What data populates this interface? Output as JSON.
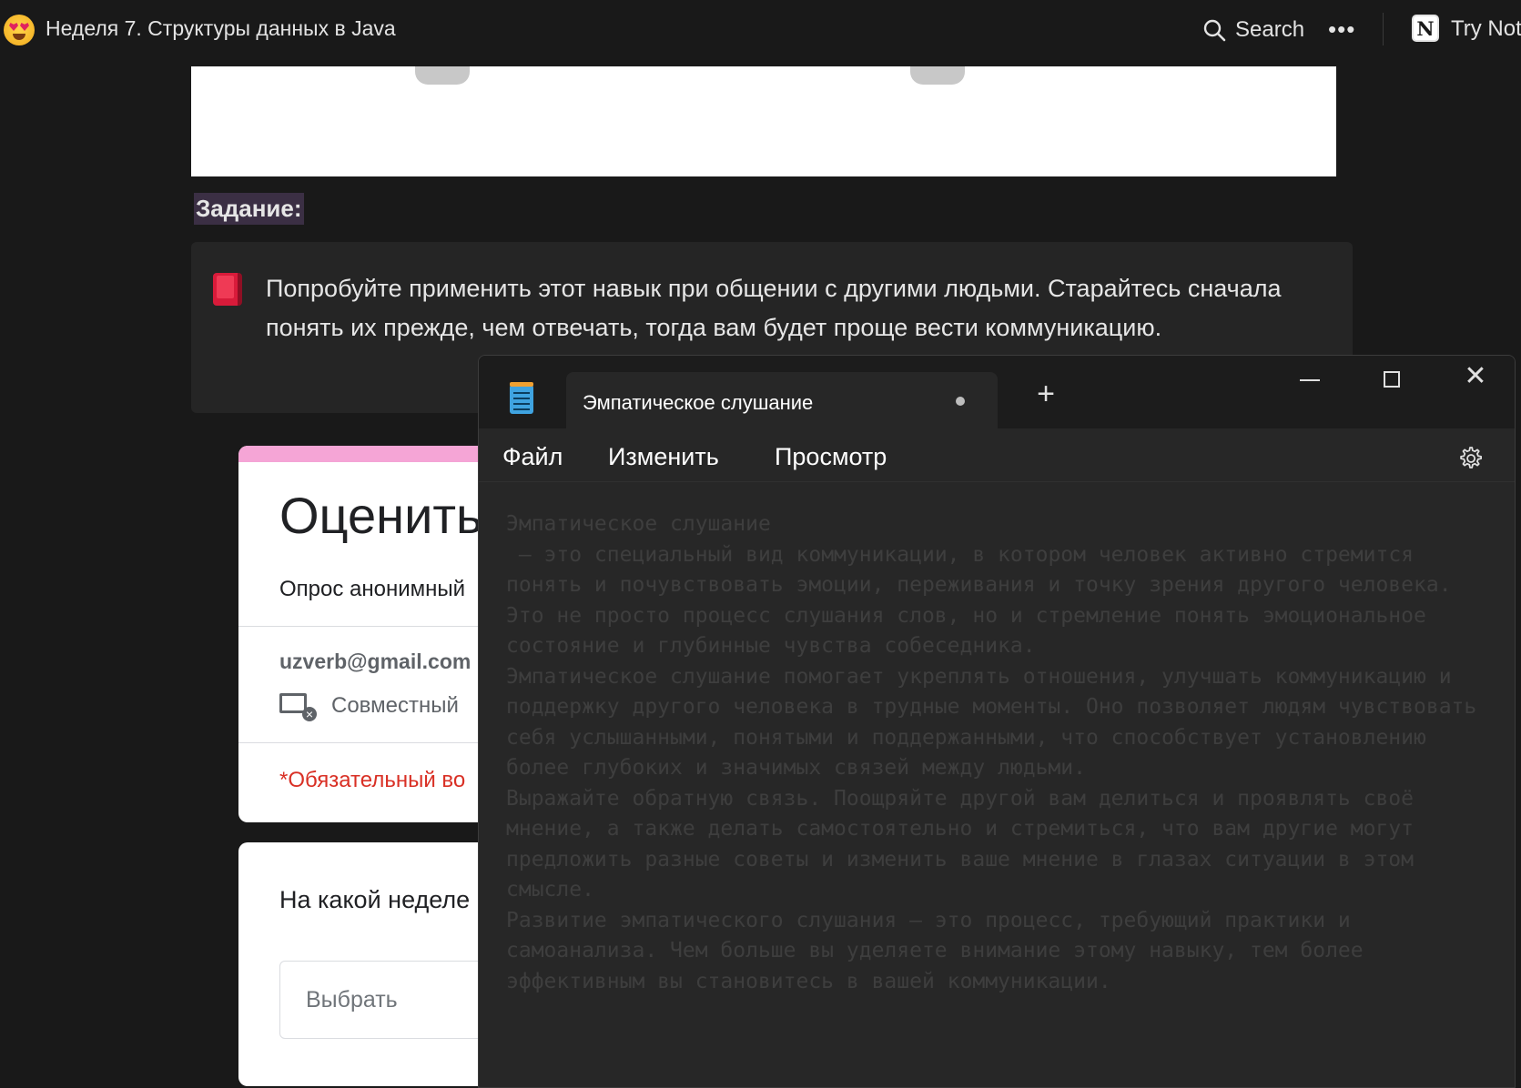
{
  "topbar": {
    "page_title": "Неделя 7. Структуры данных в Java",
    "page_icon": "smiling-face-with-heart-eyes",
    "search_label": "Search",
    "more_label": "•••",
    "try_notion_label": "Try Notion"
  },
  "content": {
    "task_heading": "Задание:",
    "callout_icon": "red-book",
    "callout_text": "Попробуйте применить этот навык при общении с другими людьми. Старайтесь сначала понять их прежде, чем отвечать, тогда вам будет проще вести коммуникацию."
  },
  "form": {
    "accent_color": "#f5a5d6",
    "title": "Оценить",
    "description": "Опрос анонимный",
    "email": "uzverb@gmail.com",
    "shared_label": "Совместный",
    "required_note": "*Обязательный во",
    "question": "На какой неделе",
    "select_placeholder": "Выбрать"
  },
  "notepad": {
    "tab_title": "Эмпатическое слушание",
    "menu": [
      "Файл",
      "Изменить",
      "Просмотр"
    ],
    "text": "Эмпатическое слушание\n — это специальный вид коммуникации, в котором человек активно стремится понять и почувствовать эмоции, переживания и точку зрения другого человека. Это не просто процесс слушания слов, но и стремление понять эмоциональное состояние и глубинные чувства собеседника.\nЭмпатическое слушание помогает укреплять отношения, улучшать коммуникацию и поддержку другого человека в трудные моменты. Оно позволяет людям чувствовать себя услышанными, понятыми и поддержанными, что способствует установлению более глубоких и значимых связей между людьми.\nВыражайте обратную связь. Поощряйте другой вам делиться и проявлять своё мнение, а также делать самостоятельно и стремиться, что вам другие могут предложить разные советы и изменить ваше мнение в глазах ситуации в этом смысле.\nРазвитие эмпатического слушания — это процесс, требующий практики и самоанализа. Чем больше вы уделяете внимание этому навыку, тем более эффективным вы становитесь в вашей коммуникации."
  }
}
